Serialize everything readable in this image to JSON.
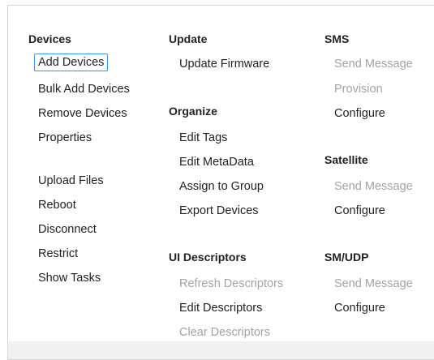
{
  "devices": {
    "heading": "Devices",
    "items": [
      {
        "label": "Add Devices"
      },
      {
        "label": "Bulk Add Devices"
      },
      {
        "label": "Remove Devices"
      },
      {
        "label": "Properties"
      },
      {
        "label": "Upload Files"
      },
      {
        "label": "Reboot"
      },
      {
        "label": "Disconnect"
      },
      {
        "label": "Restrict"
      },
      {
        "label": "Show Tasks"
      }
    ]
  },
  "update": {
    "heading": "Update",
    "items": [
      {
        "label": "Update Firmware"
      }
    ]
  },
  "organize": {
    "heading": "Organize",
    "items": [
      {
        "label": "Edit Tags"
      },
      {
        "label": "Edit MetaData"
      },
      {
        "label": "Assign to Group"
      },
      {
        "label": "Export Devices"
      }
    ]
  },
  "ui_descriptors": {
    "heading": "UI Descriptors",
    "items": [
      {
        "label": "Refresh Descriptors",
        "disabled": true
      },
      {
        "label": "Edit Descriptors"
      },
      {
        "label": "Clear Descriptors",
        "disabled": true
      }
    ]
  },
  "sms": {
    "heading": "SMS",
    "items": [
      {
        "label": "Send Message",
        "disabled": true
      },
      {
        "label": "Provision",
        "disabled": true
      },
      {
        "label": "Configure"
      }
    ]
  },
  "satellite": {
    "heading": "Satellite",
    "items": [
      {
        "label": "Send Message",
        "disabled": true
      },
      {
        "label": "Configure"
      }
    ]
  },
  "sm_udp": {
    "heading": "SM/UDP",
    "items": [
      {
        "label": "Send Message",
        "disabled": true
      },
      {
        "label": "Configure"
      }
    ]
  },
  "colors": {
    "text": "#222222",
    "disabled_text": "#a3a3a3",
    "focus_border": "#4a90d9",
    "frame_border": "#cfd6dc",
    "footer_band": "#f1f1f1"
  }
}
